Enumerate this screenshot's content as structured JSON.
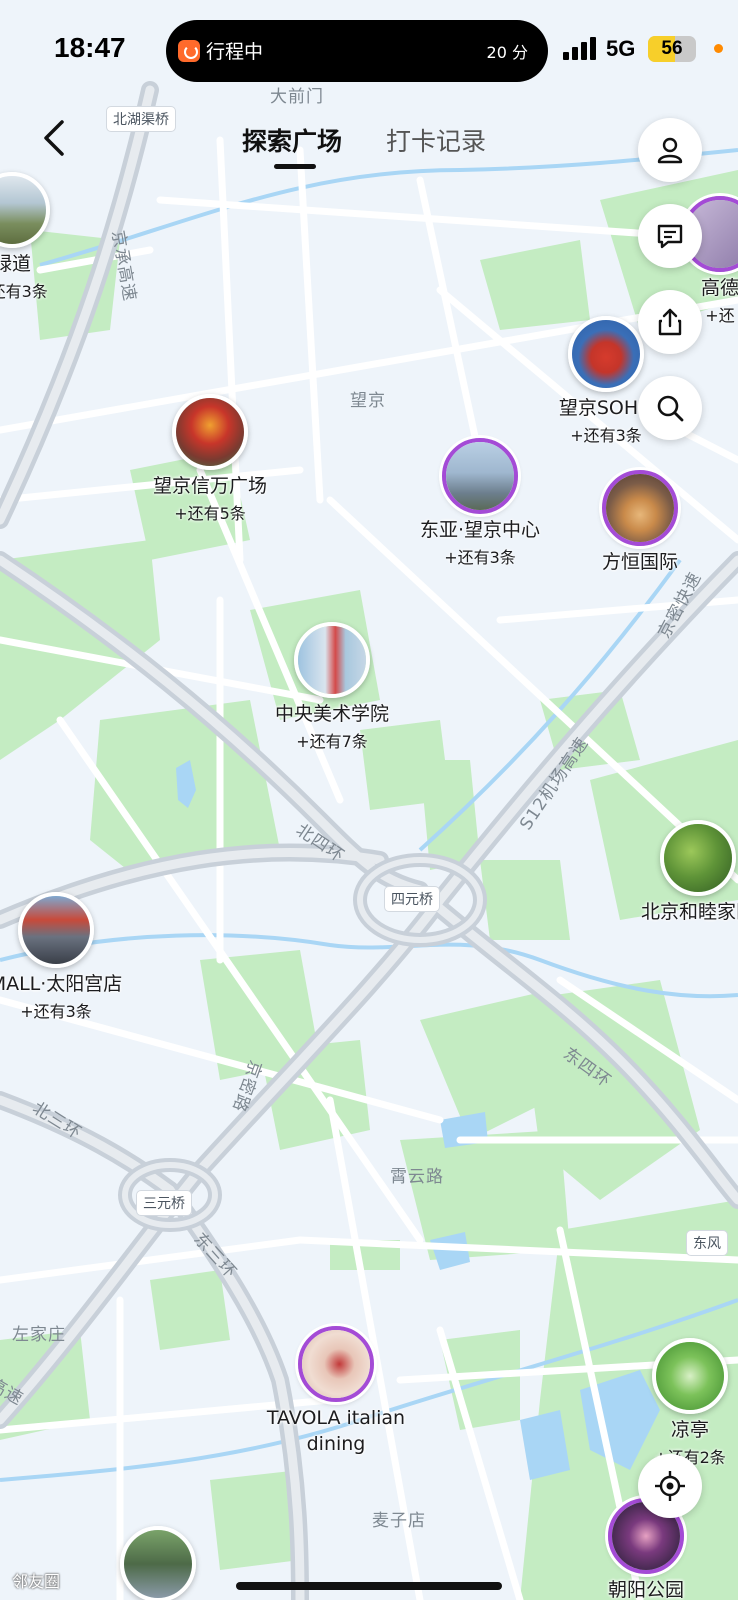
{
  "status_bar": {
    "time": "18:47",
    "trip_label": "行程中",
    "trip_minutes": "20 分",
    "network": "5G",
    "battery": "56",
    "battery_fraction": 0.56
  },
  "header": {
    "tabs": [
      {
        "label": "探索广场",
        "active": true
      },
      {
        "label": "打卡记录",
        "active": false
      }
    ]
  },
  "side_buttons": [
    "user-icon",
    "message-icon",
    "share-icon",
    "search-icon"
  ],
  "locate_button": "locate-icon",
  "map_labels": {
    "beihuqu_bridge": "北湖渠桥",
    "damenmen": "大前门",
    "jingcheng_expressway": "京承高速",
    "wangjing": "望京",
    "jingmi_expressway": "京密快速",
    "s12_airport": "S12机场高速",
    "north_4th_ring": "北四环",
    "siyuan_bridge": "四元桥",
    "east_4th_ring": "东四环",
    "north_3rd_ring": "北三环",
    "jingmi_road": "京密路",
    "xiaoyun_road": "霄云路",
    "sanyuan_bridge": "三元桥",
    "east_3rd_ring": "东三环",
    "zuojiazhuang": "左家庄",
    "maizidian": "麦子店",
    "dongfeng": "东风",
    "edge_speed": "高速"
  },
  "markers": [
    {
      "name": "绿道",
      "more": "+还有3条",
      "purple": false
    },
    {
      "name": "高德",
      "more": "+还",
      "purple": false
    },
    {
      "name": "望京SOHO",
      "more": "+还有3条",
      "purple": false
    },
    {
      "name": "望京信万广场",
      "more": "+还有5条",
      "purple": false
    },
    {
      "name": "东亚·望京中心",
      "more": "+还有3条",
      "purple": true
    },
    {
      "name": "方恒国际",
      "more": "",
      "purple": true
    },
    {
      "name": "中央美术学院",
      "more": "+还有7条",
      "purple": false
    },
    {
      "name": "北京和睦家医",
      "more": "",
      "purple": false
    },
    {
      "name": "MALL·太阳宫店",
      "more": "+还有3条",
      "purple": false
    },
    {
      "name": "TAVOLA italian dining",
      "more": "",
      "purple": true
    },
    {
      "name": "凉亭",
      "more": "+还有2条",
      "purple": false
    },
    {
      "name": "朝阳公园",
      "more": "",
      "purple": true
    },
    {
      "name": "",
      "more": "",
      "purple": false
    }
  ],
  "bottom_label": "邻友圈"
}
